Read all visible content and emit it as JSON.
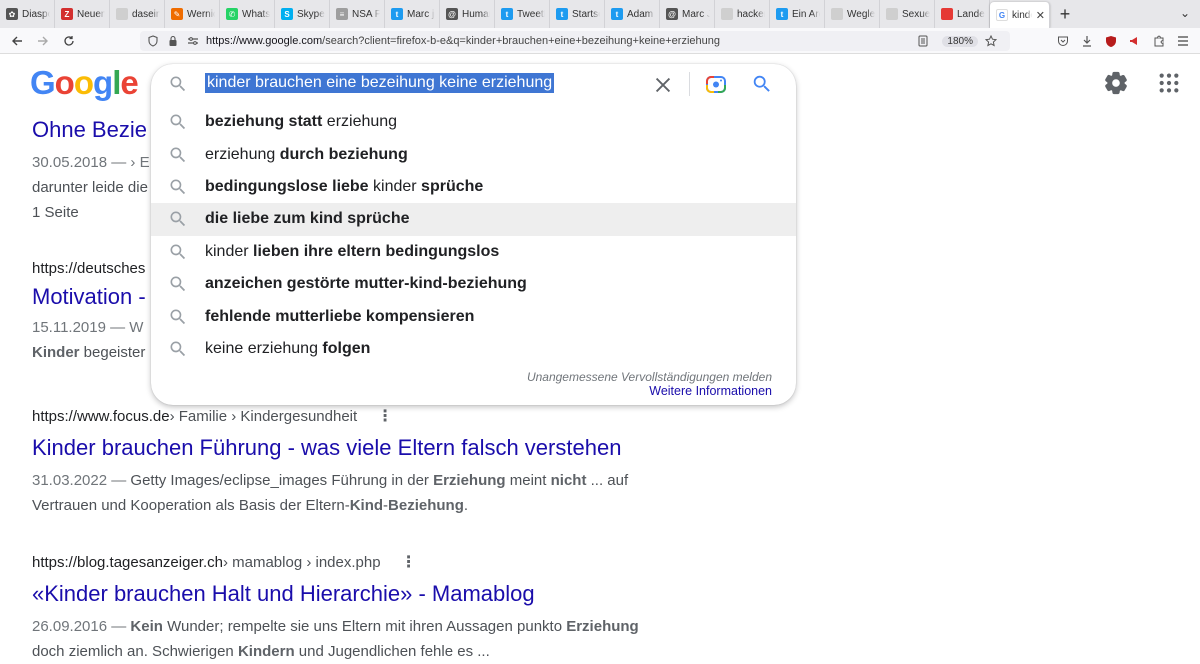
{
  "browser": {
    "tabs": [
      {
        "label": "Diaspor",
        "fav_color": "#555555",
        "fav_glyph": "✿"
      },
      {
        "label": "Neuenb",
        "fav_color": "#d32f2f",
        "fav_glyph": "Z"
      },
      {
        "label": "daseinsana",
        "fav_color": "#cfcfcf",
        "fav_glyph": ""
      },
      {
        "label": "Wernick",
        "fav_color": "#ef6c00",
        "fav_glyph": "✎"
      },
      {
        "label": "WhatsA",
        "fav_color": "#25d366",
        "fav_glyph": "✆"
      },
      {
        "label": "Skype",
        "fav_color": "#00aff0",
        "fav_glyph": "S"
      },
      {
        "label": "NSA PR",
        "fav_color": "#9e9e9e",
        "fav_glyph": "≡"
      },
      {
        "label": "Marc jr",
        "fav_color": "#1d9bf0",
        "fav_glyph": "t"
      },
      {
        "label": "Human",
        "fav_color": "#555555",
        "fav_glyph": "@"
      },
      {
        "label": "TweetD",
        "fav_color": "#1d9bf0",
        "fav_glyph": "t"
      },
      {
        "label": "Startsei",
        "fav_color": "#1d9bf0",
        "fav_glyph": "t"
      },
      {
        "label": "Adam W",
        "fav_color": "#1d9bf0",
        "fav_glyph": "t"
      },
      {
        "label": "Marc Jr",
        "fav_color": "#555555",
        "fav_glyph": "@"
      },
      {
        "label": "hackerscan",
        "fav_color": "#cfcfcf",
        "fav_glyph": ""
      },
      {
        "label": "Ein Arch",
        "fav_color": "#1d9bf0",
        "fav_glyph": "t"
      },
      {
        "label": "Wegleitung",
        "fav_color": "#cfcfcf",
        "fav_glyph": ""
      },
      {
        "label": "Sexuelle Au",
        "fav_color": "#cfcfcf",
        "fav_glyph": ""
      },
      {
        "label": "Landev",
        "fav_color": "#e53935",
        "fav_glyph": ""
      }
    ],
    "active_tab": {
      "label": "kinder",
      "fav_glyph": "G",
      "close": "✕"
    },
    "new_tab": "+",
    "tab_menu": "⌄",
    "url_host": "https://www.google.com",
    "url_rest": "/search?client=firefox-b-e&q=kinder+brauchen+eine+bezeihung+keine+erziehung",
    "zoom": "180%"
  },
  "search": {
    "query": "kinder brauchen eine bezeihung keine erziehung",
    "report_text": "Unangemessene Vervollständigungen melden",
    "more_info": "Weitere Informationen",
    "suggestions": [
      {
        "pre": "",
        "bold": "beziehung statt",
        "post": " erziehung"
      },
      {
        "pre": "erziehung ",
        "bold": "durch beziehung",
        "post": ""
      },
      {
        "pre": "",
        "bold": "bedingungslose liebe",
        "post": " kinder ",
        "bold2": "sprüche"
      },
      {
        "pre": "",
        "bold": "die liebe zum kind sprüche",
        "post": ""
      },
      {
        "pre": "kinder ",
        "bold": "lieben ihre eltern bedingungslos",
        "post": ""
      },
      {
        "pre": "",
        "bold": "anzeichen gestörte mutter-kind-beziehung",
        "post": ""
      },
      {
        "pre": "",
        "bold": "fehlende mutterliebe kompensieren",
        "post": ""
      },
      {
        "pre": "keine erziehung ",
        "bold": "folgen",
        "post": ""
      }
    ]
  },
  "results": {
    "r1": {
      "title": "Ohne Bezie",
      "date": "30.05.2018 — › E",
      "line2": "darunter leide die",
      "line3": "1 Seite"
    },
    "r2": {
      "cite": "https://deutsches",
      "title": "Motivation -",
      "date": "15.11.2019 — W",
      "bold": "Kinder",
      "line2": " begeister"
    },
    "r3": {
      "cite": "https://www.focus.de",
      "path": " › Familie › Kindergesundheit",
      "title": "Kinder brauchen Führung - was viele Eltern falsch verstehen",
      "date": "31.03.2022 — ",
      "s1": "Getty Images/eclipse_images Führung in der ",
      "b1": "Erziehung",
      "s2": " meint ",
      "b2": "nicht",
      "s3": " ... auf",
      "s4": "Vertrauen und Kooperation als Basis der Eltern-",
      "b3": "Kind",
      "s5": "-",
      "b4": "Beziehung",
      "s6": "."
    },
    "r4": {
      "cite": "https://blog.tagesanzeiger.ch",
      "path": " › mamablog › index.php",
      "title": "«Kinder brauchen Halt und Hierarchie» - Mamablog",
      "date": "26.09.2016 — ",
      "b1": "Kein",
      "s1": " Wunder; rempelte sie uns Eltern mit ihren Aussagen punkto ",
      "b2": "Erziehung",
      "s2": "doch ziemlich an. Schwierigen ",
      "b3": "Kindern",
      "s3": " und Jugendlichen fehle es ..."
    }
  },
  "logo": {
    "letters": [
      "G",
      "o",
      "o",
      "g",
      "l",
      "e"
    ],
    "colors": [
      "#4285f4",
      "#ea4335",
      "#fbbc05",
      "#4285f4",
      "#34a853",
      "#ea4335"
    ]
  }
}
